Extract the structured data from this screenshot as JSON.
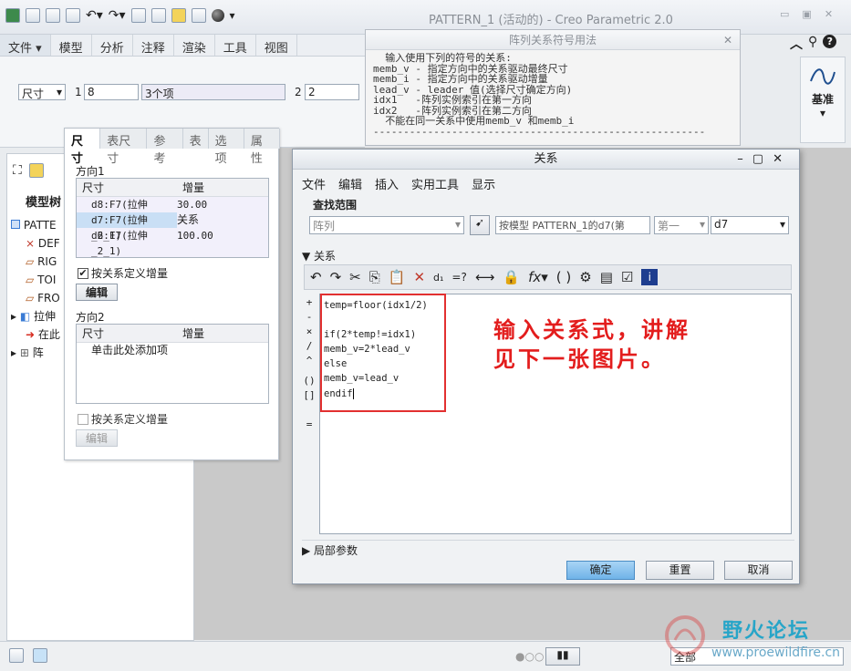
{
  "window": {
    "title": "PATTERN_1 (活动的) - Creo Parametric 2.0"
  },
  "menubar": {
    "items": [
      "文件 ▾",
      "模型",
      "分析",
      "注释",
      "渲染",
      "工具",
      "视图"
    ]
  },
  "ribbon": {
    "dim_type": "尺寸",
    "index1_label": "1",
    "index1_value": "8",
    "items_value": "3个项",
    "index2_label": "2",
    "index2_value": "2",
    "datum_label": "基准"
  },
  "tooltip": {
    "title": "阵列关系符号用法",
    "lines": [
      "  输入使用下列的符号的关系:",
      "memb_v - 指定方向中的关系驱动最终尺寸",
      "memb_i - 指定方向中的关系驱动增量",
      "lead_v - leader 值(选择尺寸确定方向)",
      "idx1   -阵列实例索引在第一方向",
      "idx2   -阵列实例索引在第二方向",
      "  不能在同一关系中使用memb_v 和memb_i",
      "-------------------------------------------------------"
    ]
  },
  "left_panel": {
    "tab_label": "模型树",
    "tree": [
      "PATTE",
      "DEF",
      "RIG",
      "TOI",
      "FRO",
      "拉伸",
      "在此",
      "阵"
    ]
  },
  "dim_panel": {
    "tabs": [
      "尺寸",
      "表尺寸",
      "参考",
      "表",
      "选项",
      "属性"
    ],
    "dir1_label": "方向1",
    "col1": "尺寸",
    "col2": "增量",
    "dir1_rows": [
      [
        "d8:F7(拉伸_2_1)",
        "30.00"
      ],
      [
        "d7:F7(拉伸_2_1)",
        "关系"
      ],
      [
        "d6:F7(拉伸_2_1)",
        "100.00"
      ]
    ],
    "dir1_check": "按关系定义增量",
    "edit_btn": "编辑",
    "dir2_label": "方向2",
    "dir2_placeholder": "单击此处添加项",
    "dir2_check": "按关系定义增量",
    "edit_btn2": "编辑"
  },
  "dialog": {
    "title": "关系",
    "menu": [
      "文件",
      "编辑",
      "插入",
      "实用工具",
      "显示"
    ],
    "search_label": "查找范围",
    "scope_value": "阵列",
    "model_value": "按模型 PATTERN_1的d7(第",
    "nth_value": "第一",
    "dim_value": "d7",
    "section_label": "关系",
    "code": "temp=floor(idx1/2)\n\nif(2*temp!=idx1)\nmemb_v=2*lead_v\nelse\nmemb_v=lead_v\nendif",
    "side_ops": [
      "+",
      "-",
      "×",
      "/",
      "^",
      "()",
      "[]",
      "="
    ],
    "annotation": "输入关系式，讲解\n见下一张图片。",
    "local_params": "局部参数",
    "ok": "确定",
    "reset": "重置",
    "cancel": "取消"
  },
  "statusbar": {
    "filter": "全部"
  },
  "watermark": {
    "line1": "野火论坛",
    "line2": "www.proewildfire.cn"
  }
}
